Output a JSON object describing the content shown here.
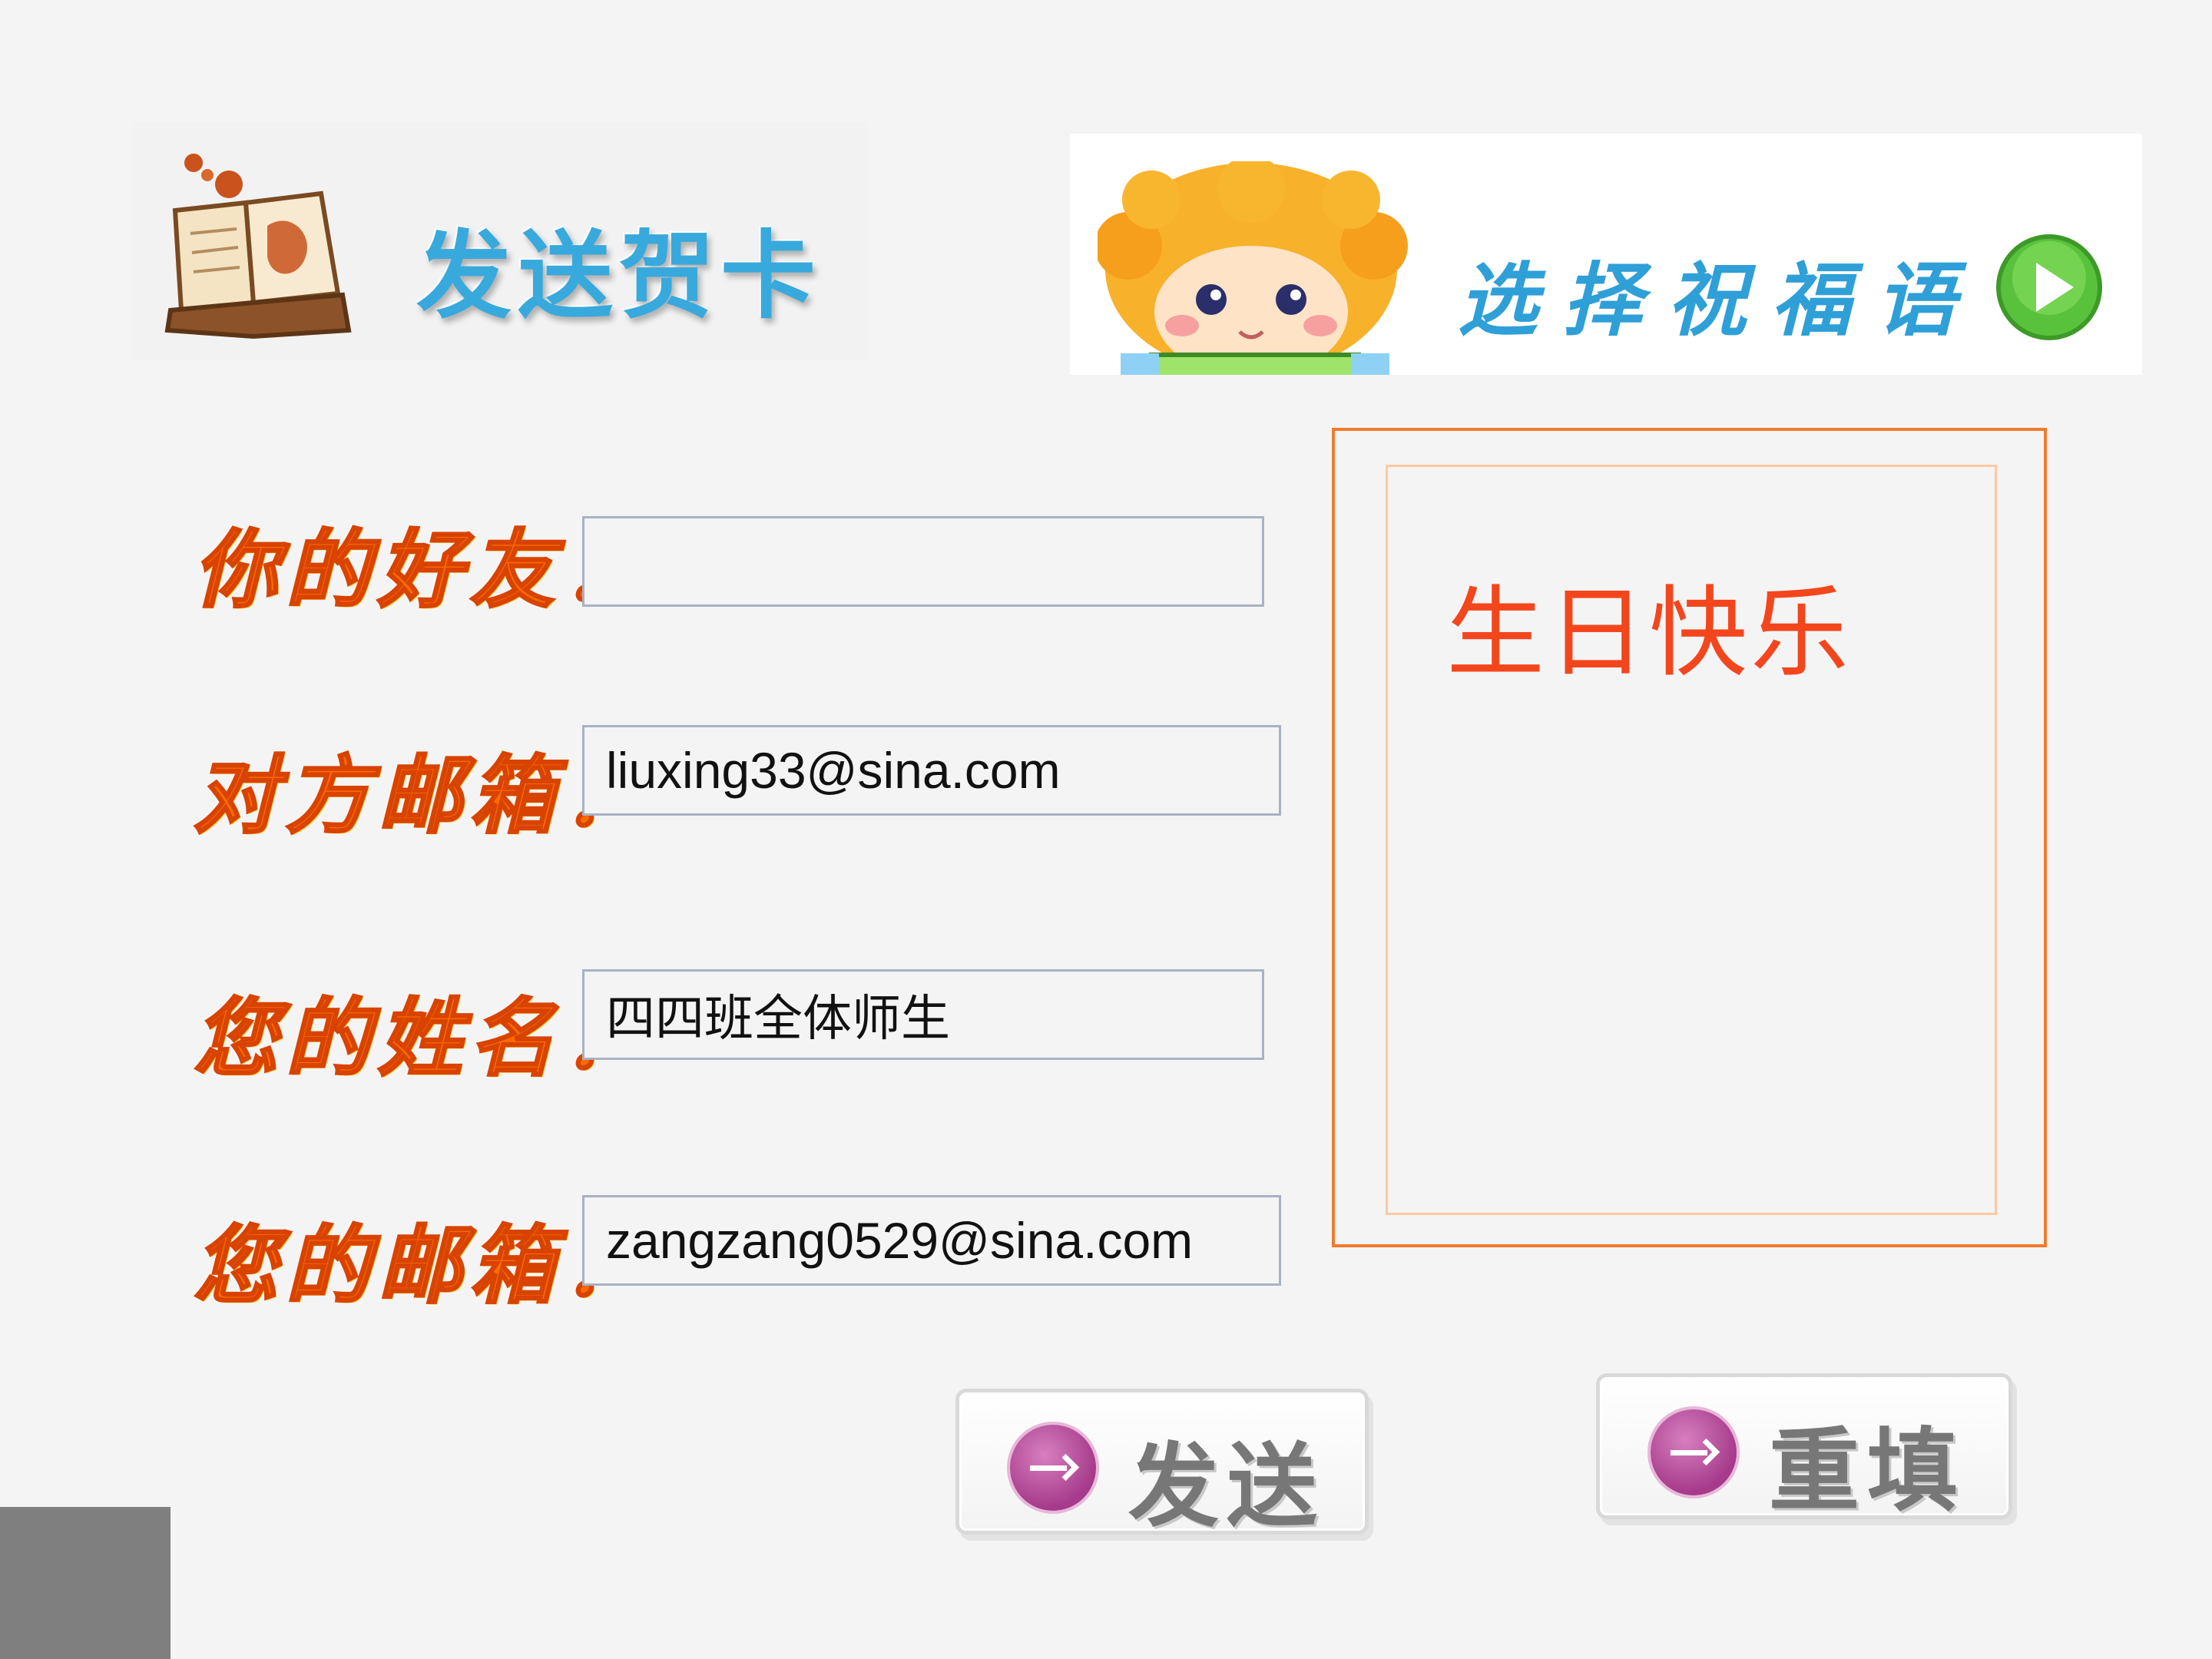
{
  "header": {
    "title": "发送贺卡",
    "icon": "open-book-icon"
  },
  "banner": {
    "label": "选择祝福语",
    "icon": "cartoon-girl-icon",
    "action_icon": "play-icon"
  },
  "form": {
    "friend_label": "你的好友：",
    "friend_value": "",
    "friend_email_label": "对方邮箱：",
    "friend_email_value": "liuxing33@sina.com",
    "your_name_label": "您的姓名：",
    "your_name_value": "四四班全体师生",
    "your_email_label": "您的邮箱：",
    "your_email_value": "zangzang0529@sina.com"
  },
  "message": {
    "text": "生日快乐"
  },
  "buttons": {
    "send_label": "发送",
    "reset_label": "重填",
    "icon": "arrow-right-icon"
  },
  "colors": {
    "page_background": "#f4f4f4",
    "label_orange": "#ff6a00",
    "message_red": "#f3461d",
    "title_blue": "#38a9dc",
    "frame_orange": "#f07a2e"
  }
}
